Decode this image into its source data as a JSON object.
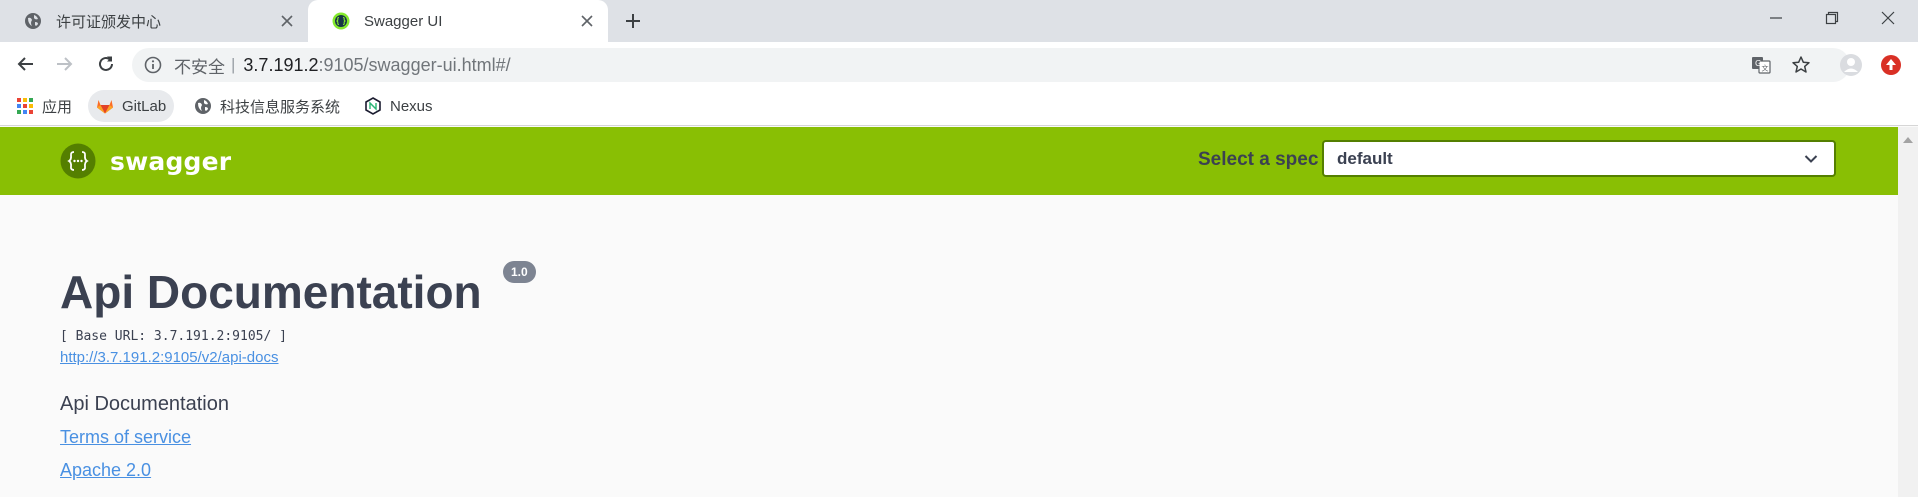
{
  "browser": {
    "tabs": [
      {
        "title": "许可证颁发中心",
        "icon": "globe-icon",
        "active": false
      },
      {
        "title": "Swagger UI",
        "icon": "swagger-favicon",
        "active": true
      }
    ],
    "url": {
      "security_label": "不安全",
      "separator": "|",
      "host": "3.7.191.2",
      "rest": ":9105/swagger-ui.html#/"
    },
    "bookmarks": [
      {
        "label": "应用",
        "icon": "apps-grid-icon"
      },
      {
        "label": "GitLab",
        "icon": "gitlab-icon"
      },
      {
        "label": "科技信息服务系统",
        "icon": "globe-icon"
      },
      {
        "label": "Nexus",
        "icon": "nexus-icon"
      }
    ]
  },
  "swagger": {
    "brand": "swagger",
    "spec_label": "Select a spec",
    "spec_selected": "default",
    "info": {
      "title": "Api Documentation",
      "version": "1.0",
      "base_url": "[ Base URL: 3.7.191.2:9105/ ]",
      "docs_link": "http://3.7.191.2:9105/v2/api-docs",
      "description": "Api Documentation",
      "terms_link": "Terms of service",
      "license_link": "Apache 2.0"
    }
  },
  "colors": {
    "topbar": "#89bf04",
    "link": "#4990e2",
    "text": "#3b4151",
    "badge": "#7d8492"
  }
}
